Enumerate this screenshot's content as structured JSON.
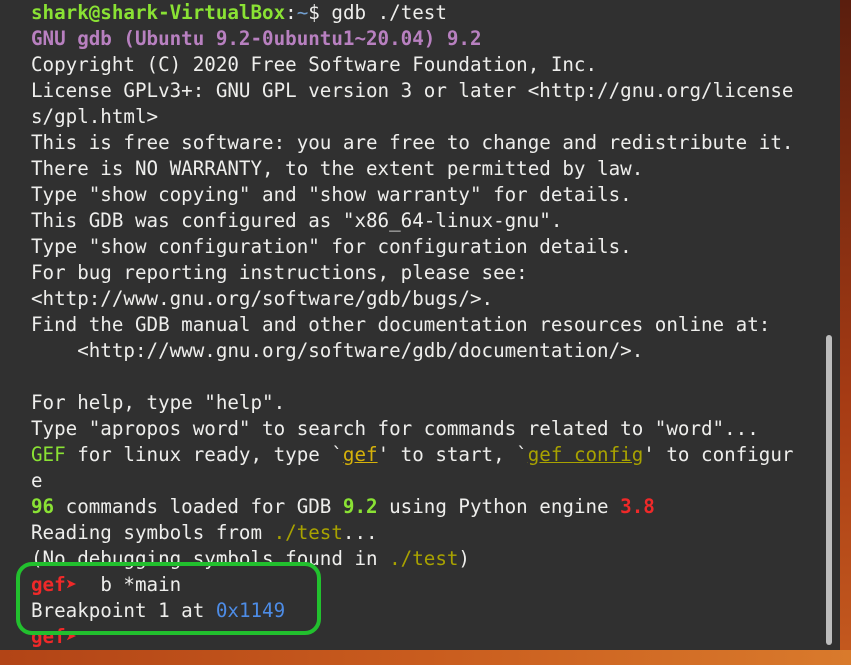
{
  "terminal": {
    "prompt_user_host": "shark@shark-VirtualBox",
    "prompt_sep": ":",
    "prompt_path": "~",
    "prompt_dollar": "$ ",
    "command": "gdb ./test",
    "gdb_banner": "GNU gdb (Ubuntu 9.2-0ubuntu1~20.04) 9.2",
    "copyright": "Copyright (C) 2020 Free Software Foundation, Inc.",
    "license_a": "License GPLv3+: GNU GPL version 3 or later <http://gnu.org/license",
    "license_b": "s/gpl.html>",
    "free_software": "This is free software: you are free to change and redistribute it.",
    "no_warranty": "There is NO WARRANTY, to the extent permitted by law.",
    "show_copying": "Type \"show copying\" and \"show warranty\" for details.",
    "configured_as": "This GDB was configured as \"x86_64-linux-gnu\".",
    "show_config": "Type \"show configuration\" for configuration details.",
    "bug_reporting": "For bug reporting instructions, please see:",
    "bug_url": "<http://www.gnu.org/software/gdb/bugs/>.",
    "find_manual": "Find the GDB manual and other documentation resources online at:",
    "doc_url": "    <http://www.gnu.org/software/gdb/documentation/>.",
    "blank": "",
    "help_hint": "For help, type \"help\".",
    "apropos_hint": "Type \"apropos word\" to search for commands related to \"word\"...",
    "gef_ready": {
      "gef": "GEF",
      "text1": " for linux ready, type `",
      "gef_cmd": "gef",
      "text2": "' to start, `",
      "gef_config": "gef config",
      "text3": "' to configur",
      "wrap": "e"
    },
    "loaded": {
      "count": "96",
      "text1": " commands loaded for GDB ",
      "gdb_version": "9.2",
      "text2": " using Python engine ",
      "python_version": "3.8"
    },
    "reading": {
      "text": "Reading symbols from ",
      "file": "./test",
      "suffix": "..."
    },
    "no_debug": {
      "text": "(No debugging symbols found in ",
      "file": "./test",
      "suffix": ")"
    },
    "gef_prompt": "gef➤ ",
    "breakpoint_cmd": " b *main",
    "breakpoint_msg": "Breakpoint 1 at ",
    "breakpoint_addr": "0x1149",
    "gef_prompt_last": "gef➤"
  },
  "colors": {
    "terminal_bg": "#303030",
    "prompt_green": "#8ae234",
    "path_blue": "#729fcf",
    "banner_purple": "#b880c0",
    "gef_red": "#ef2929",
    "address_blue": "#4d8ce6",
    "highlight_green": "#22c02e"
  }
}
